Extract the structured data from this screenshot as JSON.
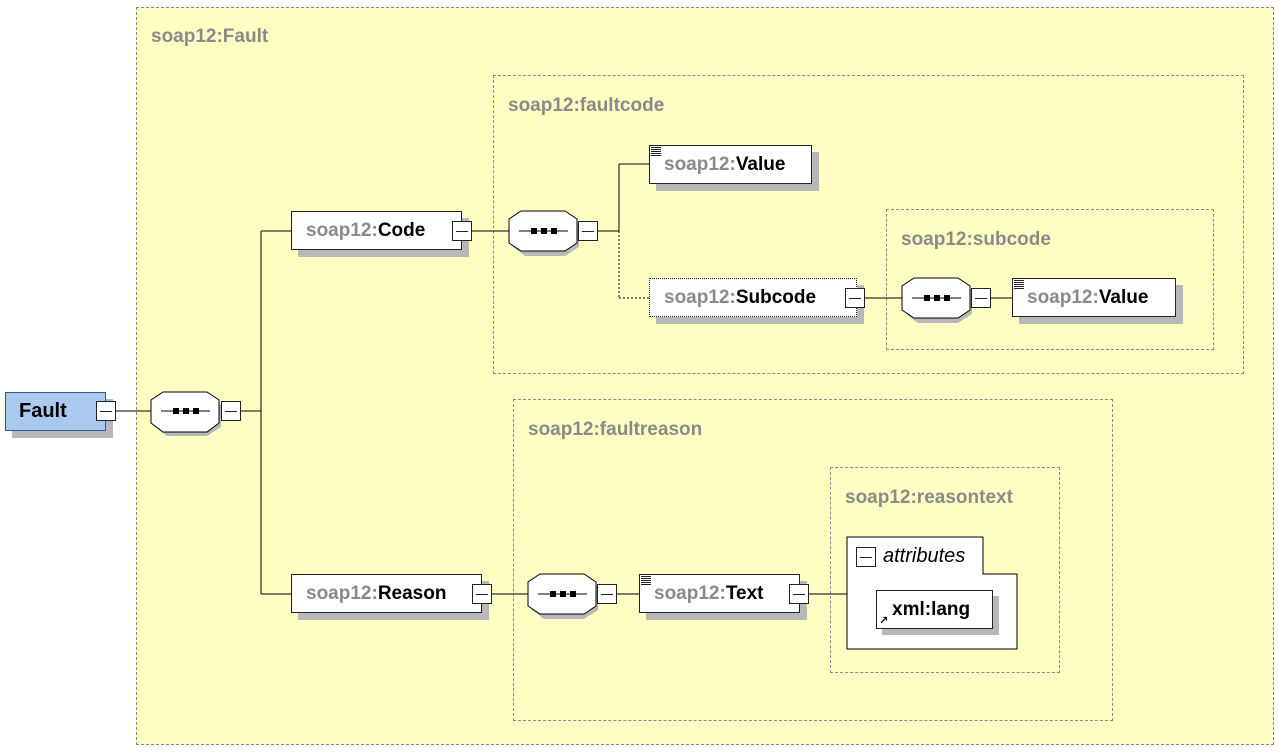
{
  "groups": {
    "fault": "soap12:Fault",
    "faultcode": "soap12:faultcode",
    "subcode": "soap12:subcode",
    "faultreason": "soap12:faultreason",
    "reasontext": "soap12:reasontext"
  },
  "nodes": {
    "root": "Fault",
    "code": {
      "prefix": "soap12:",
      "local": "Code"
    },
    "value1": {
      "prefix": "soap12:",
      "local": "Value"
    },
    "subcode": {
      "prefix": "soap12:",
      "local": "Subcode"
    },
    "value2": {
      "prefix": "soap12:",
      "local": "Value"
    },
    "reason": {
      "prefix": "soap12:",
      "local": "Reason"
    },
    "text": {
      "prefix": "soap12:",
      "local": "Text"
    }
  },
  "attributes": {
    "title": "attributes",
    "lang": "xml:lang"
  },
  "colors": {
    "group_fill": "#ffffc4",
    "root_fill": "#a9c9ef",
    "label_gray": "#8a8a8a"
  }
}
